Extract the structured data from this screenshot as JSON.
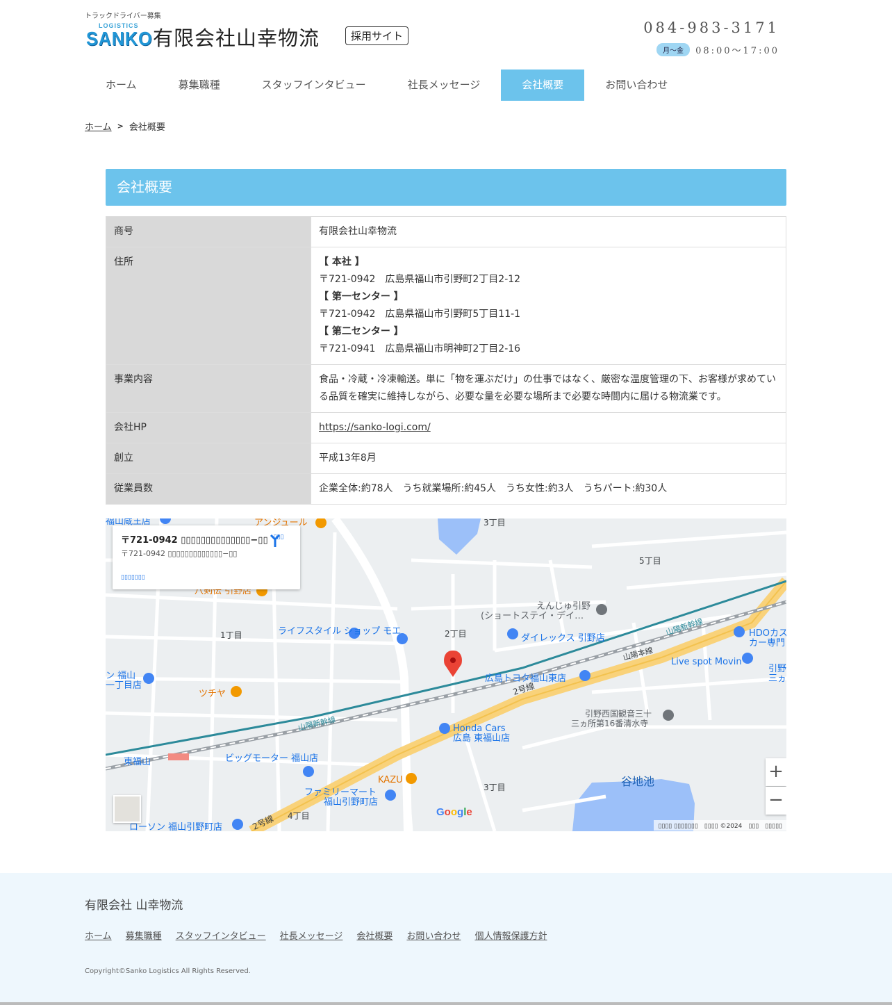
{
  "header": {
    "tagline": "トラックドライバー募集",
    "logo_small": "LOGISTICS",
    "logo_big": "SANKO",
    "company_name": "有限会社山幸物流",
    "recruit_badge": "採用サイト",
    "phone": "084-983-3171",
    "days": "月～金",
    "hours": "08:00～17:00"
  },
  "nav": [
    {
      "label": "ホーム"
    },
    {
      "label": "募集職種"
    },
    {
      "label": "スタッフインタビュー"
    },
    {
      "label": "社長メッセージ"
    },
    {
      "label": "会社概要",
      "active": true
    },
    {
      "label": "お問い合わせ"
    }
  ],
  "breadcrumb": {
    "home": "ホーム",
    "separator": ">",
    "current": "会社概要"
  },
  "section_title": "会社概要",
  "table": {
    "rows": [
      {
        "label": "商号",
        "value": "有限会社山幸物流"
      },
      {
        "label": "住所"
      },
      {
        "label": "事業内容",
        "value": "食品・冷蔵・冷凍輸送。単に「物を運ぶだけ」の仕事ではなく、厳密な温度管理の下、お客様が求めている品質を確実に維持しながら、必要な量を必要な場所まで必要な時間内に届ける物流業です。"
      },
      {
        "label": "会社HP",
        "value": "https://sanko-logi.com/"
      },
      {
        "label": "創立",
        "value": "平成13年8月"
      },
      {
        "label": "従業員数",
        "value": "企業全体:約78人　うち就業場所:約45人　うち女性:約3人　うちパート:約30人"
      }
    ],
    "addresses": [
      {
        "head": "【 本社 】",
        "line": "〒721-0942　広島県福山市引野町2丁目2-12"
      },
      {
        "head": "【 第一センター 】",
        "line": "〒721-0942　広島県福山市引野町5丁目11-1"
      },
      {
        "head": "【 第二センター 】",
        "line": "〒721-0941　広島県福山市明神町2丁目2-16"
      }
    ]
  },
  "map": {
    "info_title": "〒721-0942 ▯▯▯▯▯▯▯▯▯▯▯▯▯▯−▯▯",
    "info_addr": "〒721-0942 ▯▯▯▯▯▯▯▯▯▯▯▯▯−▯▯",
    "info_link": "▯▯▯▯▯▯▯",
    "directions": "▯▯▯",
    "zoom_in": "+",
    "zoom_out": "−",
    "google": "Google",
    "attribution": "▯▯▯▯ ▯▯▯▯▯▯▯　▯▯▯▯ ©2024　▯▯▯　▯▯▯▯▯",
    "labels": {
      "l3chome_top": "3丁目",
      "l5chome": "5丁目",
      "l1chome": "1丁目",
      "l2chome": "2丁目",
      "l3chome_bottom": "3丁目",
      "l4chome": "4丁目",
      "lifestyle": "ライフスタイル\nショップ モエ",
      "direx": "ダイレックス 引野店",
      "enju": "えんじゅ引野",
      "enju2": "(ショートステイ・デイ…",
      "hdo": "HDOカス",
      "hdo2": "カー専門",
      "livespot": "Live spot Movin",
      "toyota": "広島トヨタ福山東店",
      "route2": "2号線",
      "sanyo_honsen": "山陽本線",
      "sanyo_shinkansen": "山陽新幹線",
      "tsuchiya": "ツチヤ",
      "honda1": "Honda Cars",
      "honda2": "広島 東福山店",
      "higashifukuyama": "東福山",
      "bigmotor": "ビッグモーター 福山店",
      "kazu": "KAZU",
      "familymart1": "ファミリーマート",
      "familymart2": "福山引野町店",
      "lawson": "ローソン 福山引野町店",
      "tanijiike": "谷地池",
      "kannon1": "引野西国観音三十",
      "kannon2": "三ヵ所第16番清水寺",
      "angelure": "アンジュール",
      "hachiken": "八剣伝 引野店",
      "fukuyama_kura": "福山蔵王店",
      "hikino_right": "引野",
      "hikino_right2": "三ヵ所",
      "fukuyama_left": "ン 福山",
      "itchome_left": "一丁目店",
      "route2_lower": "2号線"
    }
  },
  "footer": {
    "company": "有限会社 山幸物流",
    "links": [
      "ホーム",
      "募集職種",
      "スタッフインタビュー",
      "社長メッセージ",
      "会社概要",
      "お問い合わせ",
      "個人情報保護方針"
    ],
    "copyright": "Copyright©Sanko Logistics All Rights Reserved."
  }
}
